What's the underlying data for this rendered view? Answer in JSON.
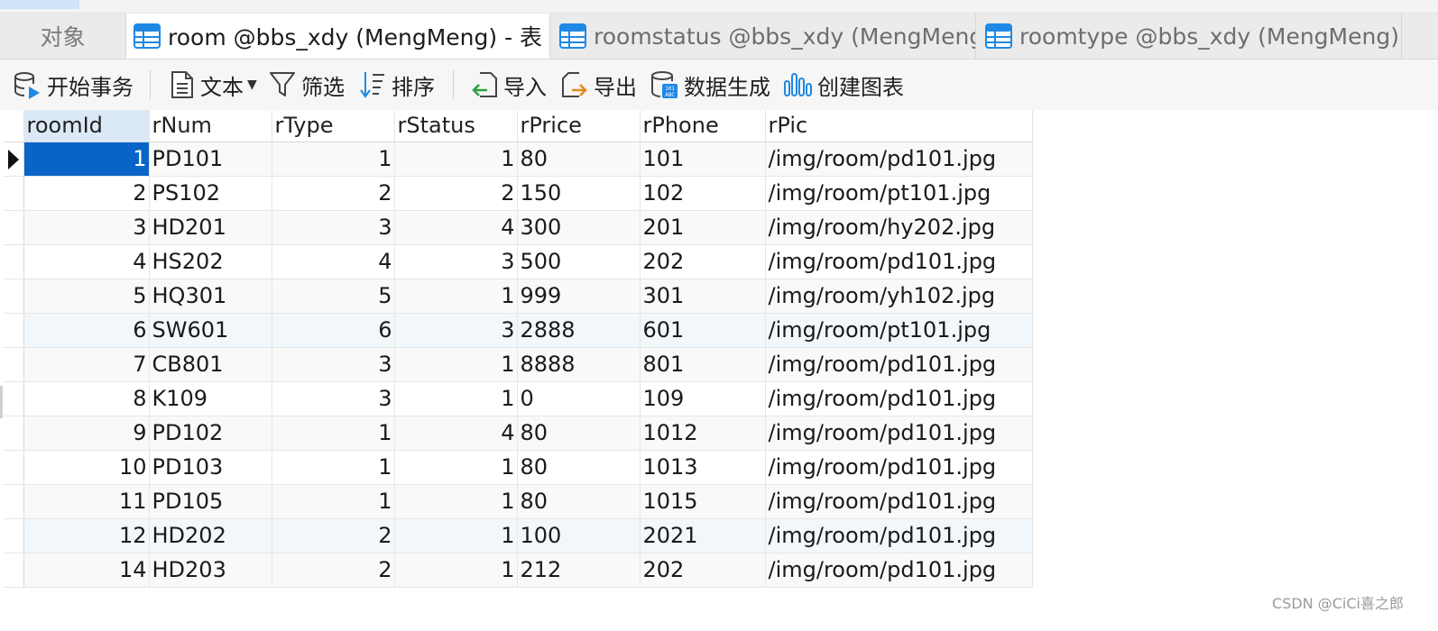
{
  "tabs": {
    "objects_label": "对象",
    "active_label": "room @bbs_xdy (MengMeng) - 表",
    "tab2_label": "roomstatus @bbs_xdy (MengMeng...",
    "tab3_label": "roomtype @bbs_xdy (MengMeng) ..."
  },
  "toolbar": {
    "begin_transaction": "开始事务",
    "text": "文本",
    "filter": "筛选",
    "sort": "排序",
    "import": "导入",
    "export": "导出",
    "data_generation": "数据生成",
    "create_chart": "创建图表"
  },
  "grid": {
    "columns": [
      "roomId",
      "rNum",
      "rType",
      "rStatus",
      "rPrice",
      "rPhone",
      "rPic"
    ],
    "rows": [
      [
        "1",
        "PD101",
        "1",
        "1",
        "80",
        "101",
        "/img/room/pd101.jpg"
      ],
      [
        "2",
        "PS102",
        "2",
        "2",
        "150",
        "102",
        "/img/room/pt101.jpg"
      ],
      [
        "3",
        "HD201",
        "3",
        "4",
        "300",
        "201",
        "/img/room/hy202.jpg"
      ],
      [
        "4",
        "HS202",
        "4",
        "3",
        "500",
        "202",
        "/img/room/pd101.jpg"
      ],
      [
        "5",
        "HQ301",
        "5",
        "1",
        "999",
        "301",
        "/img/room/yh102.jpg"
      ],
      [
        "6",
        "SW601",
        "6",
        "3",
        "2888",
        "601",
        "/img/room/pt101.jpg"
      ],
      [
        "7",
        "CB801",
        "3",
        "1",
        "8888",
        "801",
        "/img/room/pd101.jpg"
      ],
      [
        "8",
        "K109",
        "3",
        "1",
        "0",
        "109",
        "/img/room/pd101.jpg"
      ],
      [
        "9",
        "PD102",
        "1",
        "4",
        "80",
        "1012",
        "/img/room/pd101.jpg"
      ],
      [
        "10",
        "PD103",
        "1",
        "1",
        "80",
        "1013",
        "/img/room/pd101.jpg"
      ],
      [
        "11",
        "PD105",
        "1",
        "1",
        "80",
        "1015",
        "/img/room/pd101.jpg"
      ],
      [
        "12",
        "HD202",
        "2",
        "1",
        "100",
        "2021",
        "/img/room/pd101.jpg"
      ],
      [
        "14",
        "HD203",
        "2",
        "1",
        "212",
        "202",
        "/img/room/pd101.jpg"
      ]
    ]
  },
  "watermark": "CSDN @CiCi喜之郎",
  "colors": {
    "selection": "#0a64c8",
    "header_sorted": "#dbe9f7",
    "icon_blue": "#1e88e5"
  }
}
